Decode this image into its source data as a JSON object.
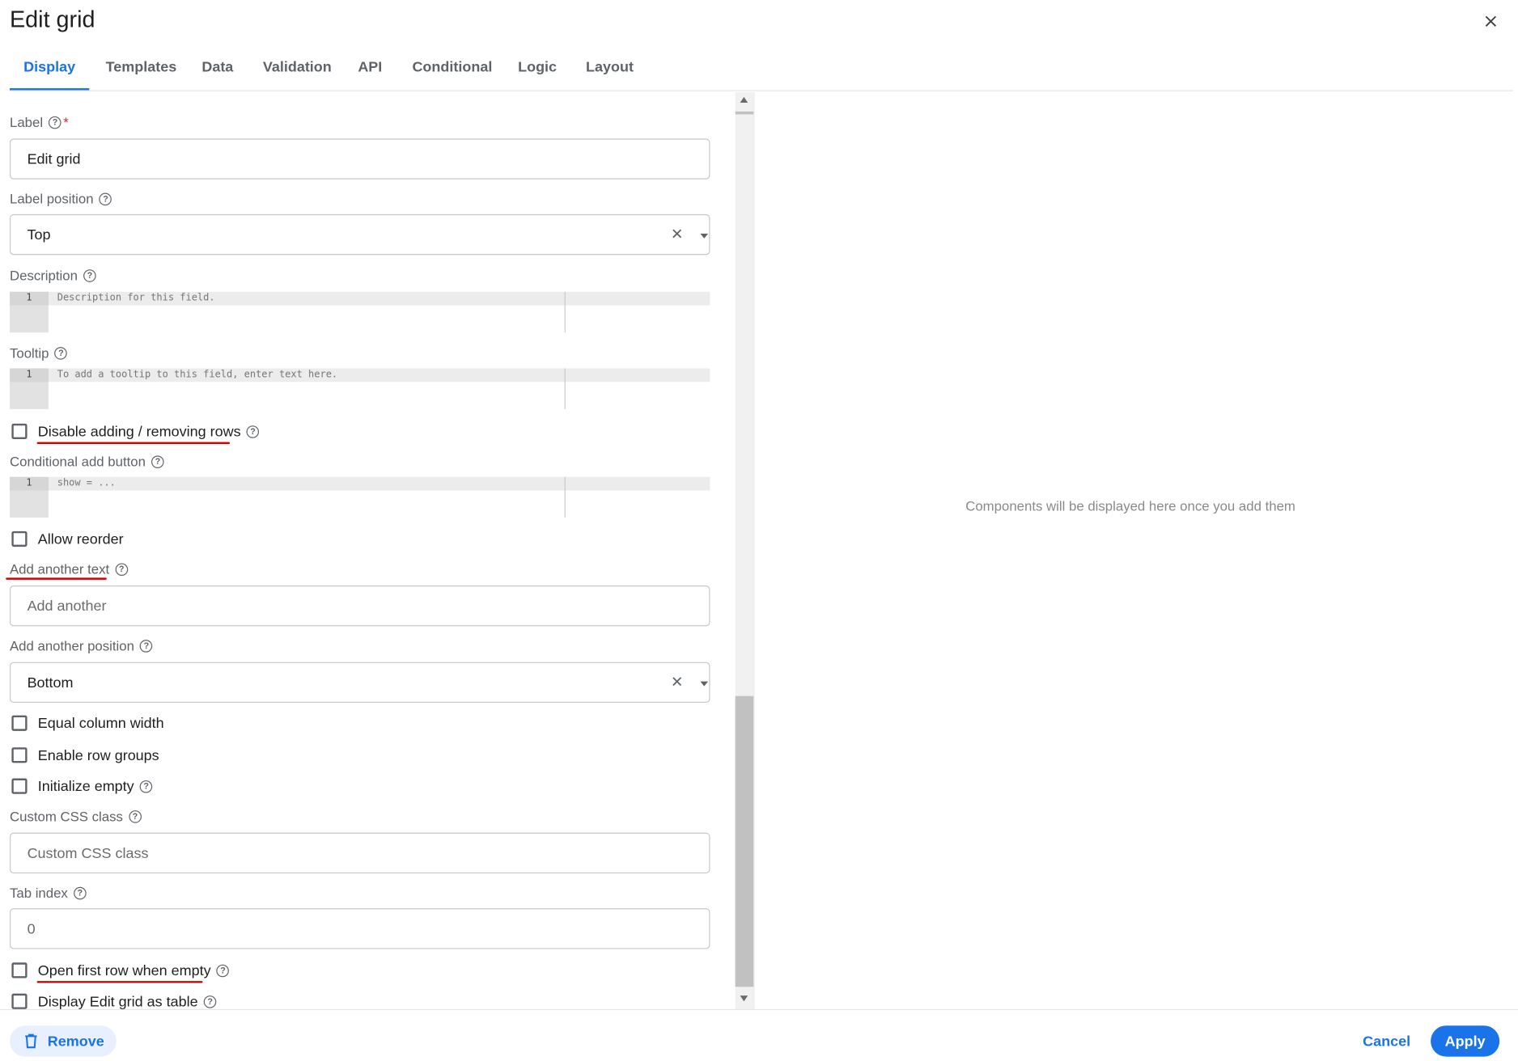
{
  "dialog": {
    "title": "Edit grid"
  },
  "tabs": [
    {
      "label": "Display",
      "active": true
    },
    {
      "label": "Templates"
    },
    {
      "label": "Data"
    },
    {
      "label": "Validation"
    },
    {
      "label": "API"
    },
    {
      "label": "Conditional"
    },
    {
      "label": "Logic"
    },
    {
      "label": "Layout"
    }
  ],
  "form": {
    "label": {
      "label": "Label",
      "required_mark": "*",
      "value": "Edit grid"
    },
    "label_position": {
      "label": "Label position",
      "value": "Top"
    },
    "description": {
      "label": "Description",
      "line_number": "1",
      "placeholder": "Description for this field."
    },
    "tooltip": {
      "label": "Tooltip",
      "line_number": "1",
      "placeholder": "To add a tooltip to this field, enter text here."
    },
    "disable_adding_removing_rows": {
      "label": "Disable adding / removing rows",
      "checked": false
    },
    "conditional_add_button": {
      "label": "Conditional add button",
      "line_number": "1",
      "placeholder": "show = ..."
    },
    "allow_reorder": {
      "label": "Allow reorder",
      "checked": false
    },
    "add_another_text": {
      "label": "Add another text",
      "placeholder": "Add another"
    },
    "add_another_position": {
      "label": "Add another position",
      "value": "Bottom"
    },
    "equal_column_width": {
      "label": "Equal column width",
      "checked": false
    },
    "enable_row_groups": {
      "label": "Enable row groups",
      "checked": false
    },
    "initialize_empty": {
      "label": "Initialize empty",
      "checked": false
    },
    "custom_css_class": {
      "label": "Custom CSS class",
      "placeholder": "Custom CSS class"
    },
    "tab_index": {
      "label": "Tab index",
      "placeholder": "0"
    },
    "open_first_row_when_empty": {
      "label": "Open first row when empty",
      "checked": false
    },
    "display_as_table": {
      "label": "Display Edit grid as table",
      "checked": false
    }
  },
  "help_glyph": "?",
  "preview": {
    "empty_message": "Components will be displayed here once you add them"
  },
  "footer": {
    "remove_label": "Remove",
    "cancel_label": "Cancel",
    "apply_label": "Apply"
  },
  "colors": {
    "accent": "#1a73e8",
    "annotation_underline": "#d40000"
  }
}
